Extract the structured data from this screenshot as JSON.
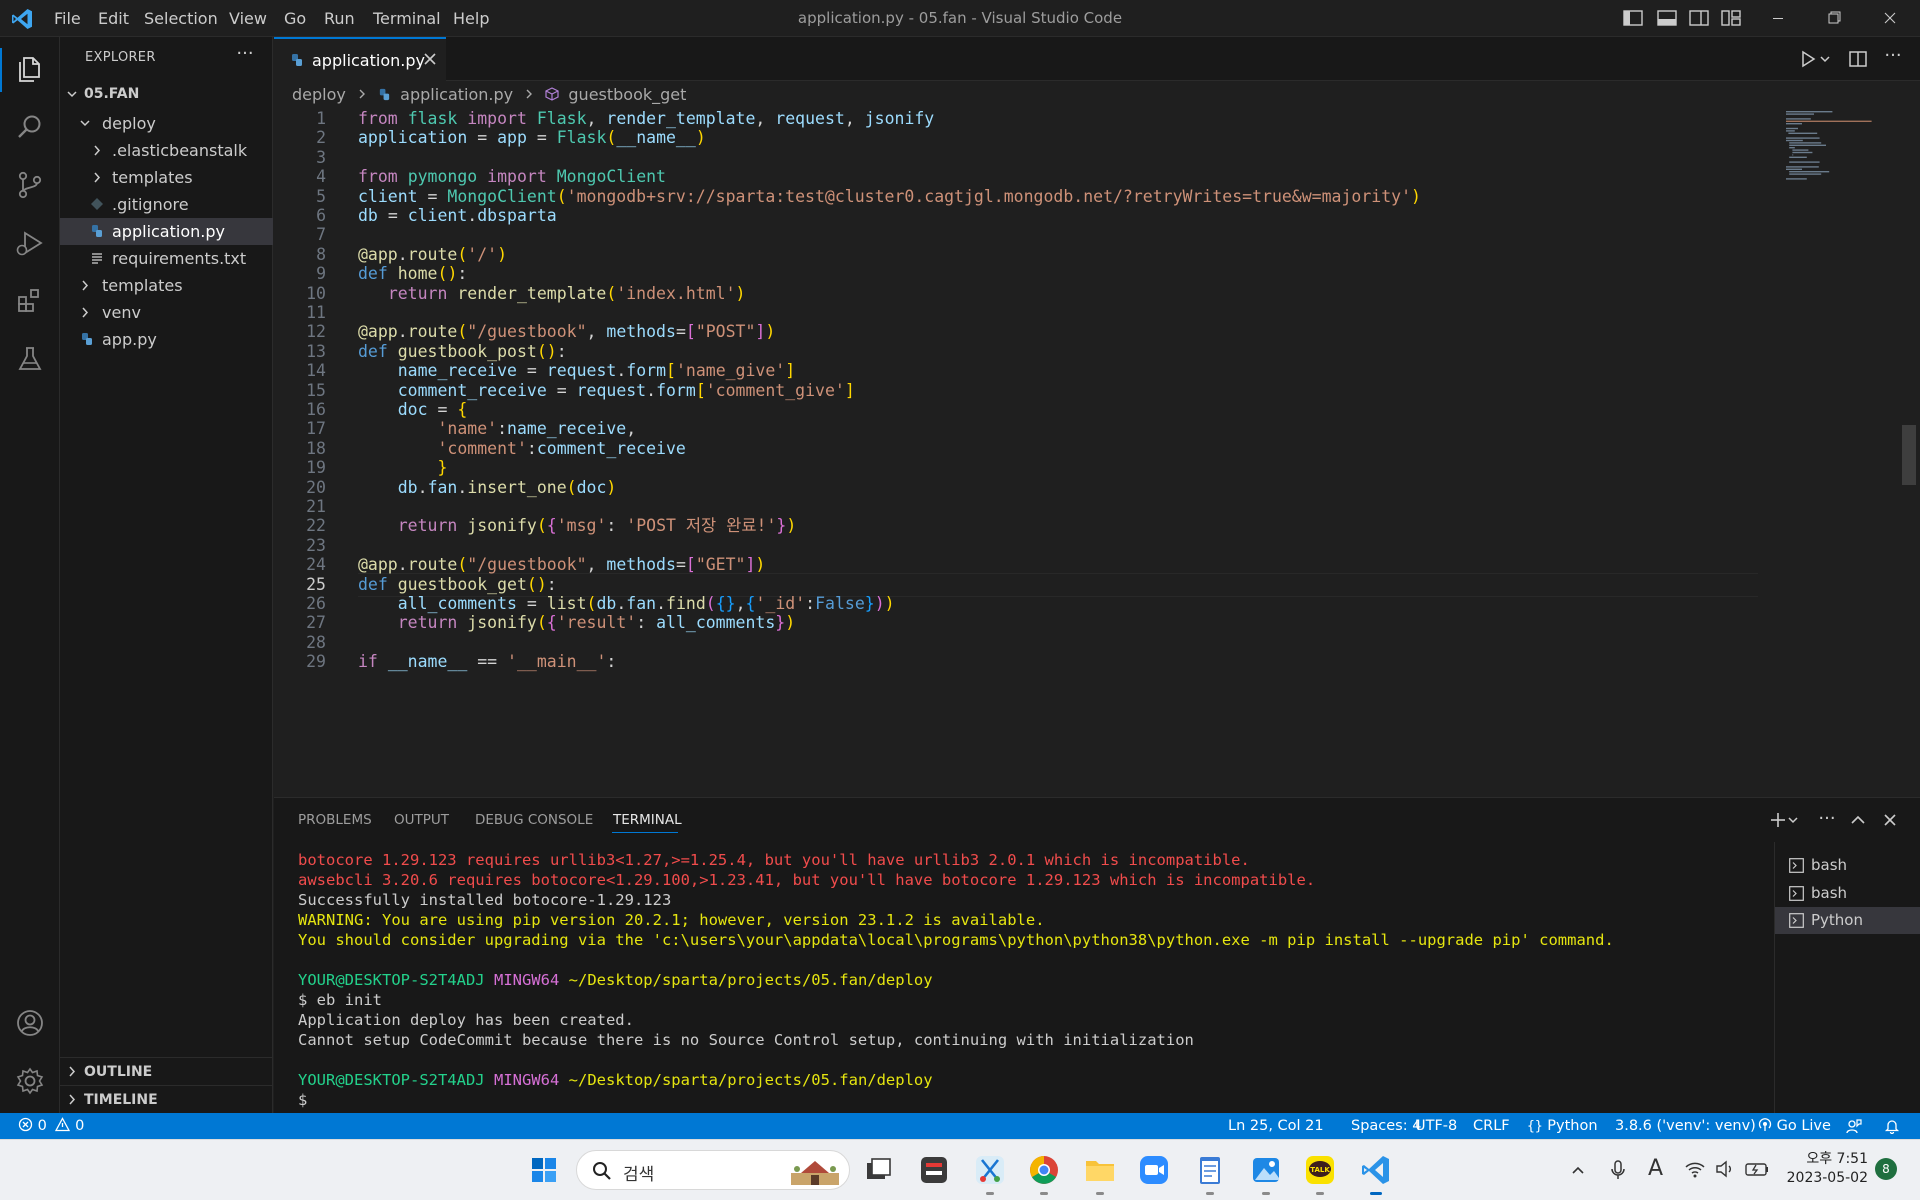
{
  "titlebar": {
    "menu": [
      "File",
      "Edit",
      "Selection",
      "View",
      "Go",
      "Run",
      "Terminal",
      "Help"
    ],
    "title": "application.py - 05.fan - Visual Studio Code"
  },
  "sidebar": {
    "title": "EXPLORER",
    "more": "···",
    "root": "05.FAN",
    "tree": [
      {
        "label": "deploy",
        "type": "folder-open",
        "depth": 1
      },
      {
        "label": ".elasticbeanstalk",
        "type": "folder",
        "depth": 2
      },
      {
        "label": "templates",
        "type": "folder",
        "depth": 2
      },
      {
        "label": ".gitignore",
        "type": "gitignore",
        "depth": 2
      },
      {
        "label": "application.py",
        "type": "python",
        "depth": 2,
        "selected": true
      },
      {
        "label": "requirements.txt",
        "type": "text",
        "depth": 2
      },
      {
        "label": "templates",
        "type": "folder",
        "depth": 1
      },
      {
        "label": "venv",
        "type": "folder",
        "depth": 1
      },
      {
        "label": "app.py",
        "type": "python",
        "depth": 1
      }
    ],
    "outline": "OUTLINE",
    "timeline": "TIMELINE"
  },
  "editor": {
    "tab": "application.py",
    "breadcrumb": {
      "folder": "deploy",
      "file": "application.py",
      "symbol": "guestbook_get"
    },
    "current_line": 25,
    "code": [
      "from flask import Flask, render_template, request, jsonify",
      "application = app = Flask(__name__)",
      "",
      "from pymongo import MongoClient",
      "client = MongoClient('mongodb+srv://sparta:test@cluster0.cagtjgl.mongodb.net/?retryWrites=true&w=majority')",
      "db = client.dbsparta",
      "",
      "@app.route('/')",
      "def home():",
      "   return render_template('index.html')",
      "",
      "@app.route(\"/guestbook\", methods=[\"POST\"])",
      "def guestbook_post():",
      "    name_receive = request.form['name_give']",
      "    comment_receive = request.form['comment_give']",
      "    doc = {",
      "        'name':name_receive,",
      "        'comment':comment_receive",
      "        }",
      "    db.fan.insert_one(doc)",
      "",
      "    return jsonify({'msg': 'POST 저장 완료!'})",
      "",
      "@app.route(\"/guestbook\", methods=[\"GET\"])",
      "def guestbook_get():",
      "    all_comments = list(db.fan.find({},{'_id':False}))",
      "    return jsonify({'result': all_comments})",
      "",
      "if __name__ == '__main__':"
    ]
  },
  "panel": {
    "tabs": [
      "PROBLEMS",
      "OUTPUT",
      "DEBUG CONSOLE",
      "TERMINAL"
    ],
    "active_tab": "TERMINAL",
    "terminal_lines": [
      {
        "text": "botocore 1.29.123 requires urllib3<1.27,>=1.25.4, but you'll have urllib3 2.0.1 which is incompatible.",
        "color": "red"
      },
      {
        "text": "awsebcli 3.20.6 requires botocore<1.29.100,>1.23.41, but you'll have botocore 1.29.123 which is incompatible.",
        "color": "red"
      },
      {
        "text": "Successfully installed botocore-1.29.123",
        "color": "default"
      },
      {
        "text": "WARNING: You are using pip version 20.2.1; however, version 23.1.2 is available.",
        "color": "yellow"
      },
      {
        "text": "You should consider upgrading via the 'c:\\users\\your\\appdata\\local\\programs\\python\\python38\\python.exe -m pip install --upgrade pip' command.",
        "color": "yellow"
      },
      {
        "text": "",
        "color": "default"
      },
      {
        "prompt": true,
        "user": "YOUR@DESKTOP-S2T4ADJ",
        "shell": "MINGW64",
        "path": "~/Desktop/sparta/projects/05.fan/deploy"
      },
      {
        "text": "$ eb init",
        "color": "default"
      },
      {
        "text": "Application deploy has been created.",
        "color": "default"
      },
      {
        "text": "Cannot setup CodeCommit because there is no Source Control setup, continuing with initialization",
        "color": "default"
      },
      {
        "text": "",
        "color": "default"
      },
      {
        "prompt": true,
        "user": "YOUR@DESKTOP-S2T4ADJ",
        "shell": "MINGW64",
        "path": "~/Desktop/sparta/projects/05.fan/deploy"
      },
      {
        "text": "$",
        "color": "default"
      }
    ],
    "terminals": [
      {
        "label": "bash"
      },
      {
        "label": "bash"
      },
      {
        "label": "Python",
        "selected": true
      }
    ]
  },
  "statusbar": {
    "errors": "0",
    "warnings": "0",
    "position": "Ln 25, Col 21",
    "spaces": "Spaces: 4",
    "encoding": "UTF-8",
    "eol": "CRLF",
    "language": "Python",
    "interpreter": "3.8.6 ('venv': venv)",
    "golive": "Go Live"
  },
  "taskbar": {
    "search_label": "검색",
    "time": "오후 7:51",
    "date": "2023-05-02",
    "notification_count": "8",
    "kakao_label": "TALK"
  },
  "colors": {
    "accent": "#0078d4",
    "editor_bg": "#1f1f1f",
    "sidebar_bg": "#181818"
  }
}
